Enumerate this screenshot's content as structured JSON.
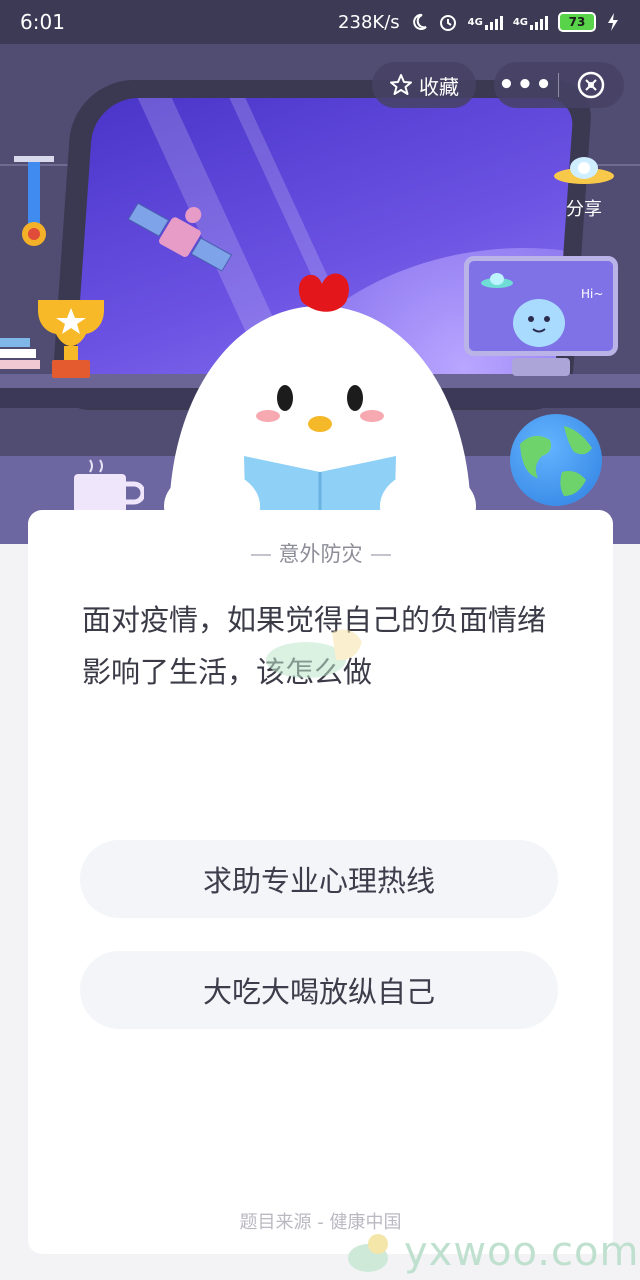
{
  "status_bar": {
    "time": "6:01",
    "net_speed": "238K/s",
    "sim1": "4G",
    "sim2": "4G",
    "battery": "73"
  },
  "header": {
    "favorite_label": "收藏",
    "more_label": "•••",
    "share_label": "分享"
  },
  "scene": {
    "monitor_greeting": "Hi~"
  },
  "quiz": {
    "category": "意外防灾",
    "question": "面对疫情，如果觉得自己的负面情绪影响了生活，该怎么做",
    "options": [
      {
        "label": "求助专业心理热线"
      },
      {
        "label": "大吃大喝放纵自己"
      }
    ],
    "source": "题目来源 - 健康中国"
  },
  "watermark": {
    "text": "yxwoo.com"
  },
  "colors": {
    "status_bar_bg": "#3c3a55",
    "scene_bg": "#514d72",
    "card_bg": "#ffffff",
    "option_bg": "#f3f5f8",
    "watermark": "#bfe0cf"
  }
}
